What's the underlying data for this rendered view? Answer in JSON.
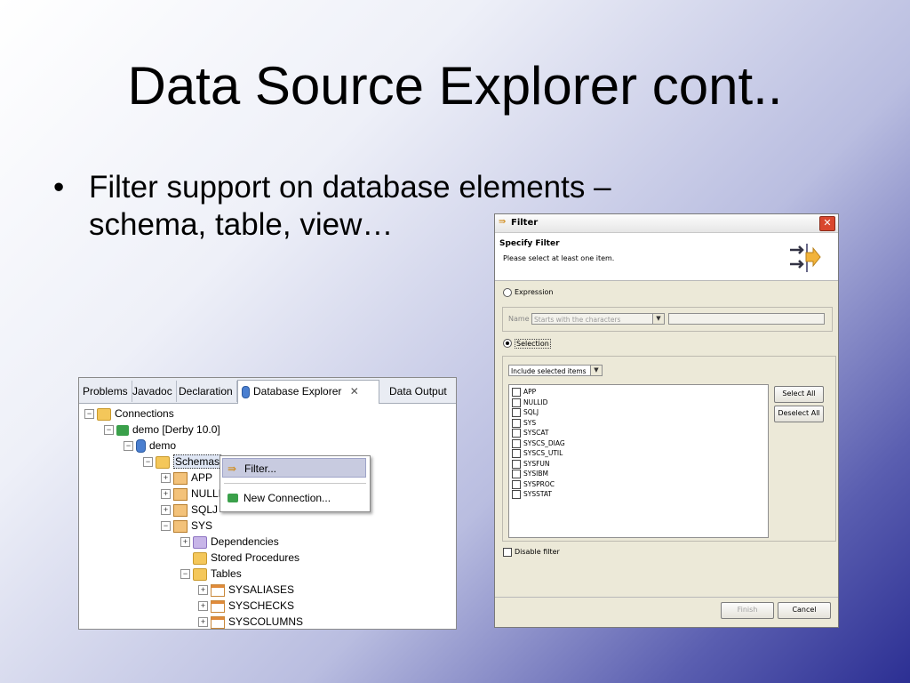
{
  "slide": {
    "title": "Data Source Explorer cont..",
    "bullet_symbol": "•",
    "bullet_text": "Filter support on database elements – schema, table, view…"
  },
  "eclipse": {
    "tabs": [
      "Problems",
      "Javadoc",
      "Declaration",
      "Database Explorer",
      "Data Output"
    ],
    "active_tab_close": "✕",
    "tree": [
      {
        "label": "Connections",
        "expander": "−"
      },
      {
        "label": "demo [Derby 10.0]",
        "expander": "−"
      },
      {
        "label": "demo",
        "expander": "−"
      },
      {
        "label": "Schemas",
        "expander": "−"
      },
      {
        "label": "APP",
        "expander": "+"
      },
      {
        "label": "NULLID",
        "expander": "+"
      },
      {
        "label": "SQLJ",
        "expander": "+"
      },
      {
        "label": "SYS",
        "expander": "−"
      },
      {
        "label": "Dependencies",
        "expander": "+"
      },
      {
        "label": "Stored Procedures",
        "expander": ""
      },
      {
        "label": "Tables",
        "expander": "−"
      },
      {
        "label": "SYSALIASES",
        "expander": "+"
      },
      {
        "label": "SYSCHECKS",
        "expander": "+"
      },
      {
        "label": "SYSCOLUMNS",
        "expander": "+"
      }
    ],
    "context_menu": {
      "filter": "Filter...",
      "new_connection": "New Connection..."
    }
  },
  "dialog": {
    "title": "Filter",
    "close": "✕",
    "header_title": "Specify Filter",
    "header_subtitle": "Please select at least one item.",
    "expression_label": "Expression",
    "name_label": "Name",
    "name_combo_value": "Starts with the characters",
    "name_text_value": "",
    "selection_label": "Selection",
    "include_combo_value": "Include selected items",
    "items": [
      "APP",
      "NULLID",
      "SQLJ",
      "SYS",
      "SYSCAT",
      "SYSCS_DIAG",
      "SYSCS_UTIL",
      "SYSFUN",
      "SYSIBM",
      "SYSPROC",
      "SYSSTAT"
    ],
    "select_all": "Select All",
    "deselect_all": "Deselect All",
    "disable_filter": "Disable filter",
    "finish": "Finish",
    "cancel": "Cancel"
  }
}
